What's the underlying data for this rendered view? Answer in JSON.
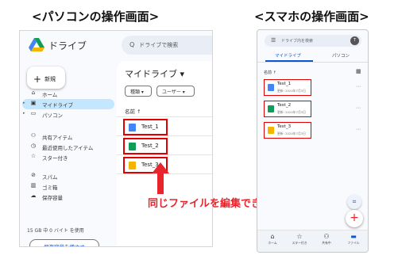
{
  "headings": {
    "pc": "<パソコンの操作画面>",
    "smartphone": "<スマホの操作画面>"
  },
  "caption": "同じファイルを編集できる",
  "colors": {
    "highlight_red": "#e00000",
    "caption_red": "#e8242d",
    "active_nav": "#c2e7ff",
    "docs_blue": "#4285f4",
    "sheets_green": "#0f9d58",
    "slides_yellow": "#f4b400",
    "accent_blue": "#0b57d0"
  },
  "pc": {
    "app_title": "ドライブ",
    "logo_icon": "google-drive-logo",
    "search_placeholder": "ドライブで検索",
    "new_button": "新規",
    "nav": [
      {
        "label": "ホーム",
        "icon": "home-icon",
        "glyph": "⌂"
      },
      {
        "label": "マイドライブ",
        "icon": "my-drive-icon",
        "glyph": "▣",
        "active": true
      },
      {
        "label": "パソコン",
        "icon": "computer-icon",
        "glyph": "▭"
      },
      {
        "label": "共有アイテム",
        "icon": "shared-icon",
        "glyph": "⚇"
      },
      {
        "label": "最近使用したアイテム",
        "icon": "recent-icon",
        "glyph": "◷"
      },
      {
        "label": "スター付き",
        "icon": "star-icon",
        "glyph": "☆"
      },
      {
        "label": "スパム",
        "icon": "spam-icon",
        "glyph": "⊘"
      },
      {
        "label": "ゴミ箱",
        "icon": "trash-icon",
        "glyph": "▥"
      },
      {
        "label": "保存容量",
        "icon": "cloud-icon",
        "glyph": "☁"
      }
    ],
    "storage_text": "15 GB 中 0 バイト を使用",
    "storage_button": "保存容量を増やす",
    "main_title": "マイドライブ ▾",
    "filters": [
      "種類 ▾",
      "ユーザー ▾"
    ],
    "column_header": "名前 ↑",
    "files": [
      {
        "name": "Test_1",
        "icon": "docs-icon",
        "color": "#4285f4"
      },
      {
        "name": "Test_2",
        "icon": "sheets-icon",
        "color": "#0f9d58"
      },
      {
        "name": "Test_3",
        "icon": "slides-icon",
        "color": "#f4b400"
      }
    ]
  },
  "smartphone": {
    "search_placeholder": "ドライブ内を検索",
    "avatar_letter": "T",
    "tabs": [
      "マイドライブ",
      "パソコン"
    ],
    "sort_label": "名前 ↑",
    "files": [
      {
        "name": "Test_1",
        "modified": "更新: 2024年7月3日",
        "icon": "docs-icon",
        "color": "#4285f4"
      },
      {
        "name": "Test_2",
        "modified": "更新: 2024年7月3日",
        "icon": "sheets-icon",
        "color": "#0f9d58"
      },
      {
        "name": "Test_3",
        "modified": "更新: 2024年7月3日",
        "icon": "slides-icon",
        "color": "#f4b400"
      }
    ],
    "bottom_nav": [
      {
        "label": "ホーム",
        "icon": "home-icon",
        "glyph": "⌂"
      },
      {
        "label": "スター付き",
        "icon": "star-icon",
        "glyph": "☆"
      },
      {
        "label": "共有中",
        "icon": "shared-icon",
        "glyph": "⚇"
      },
      {
        "label": "ファイル",
        "icon": "folder-icon",
        "glyph": "▬"
      }
    ]
  }
}
